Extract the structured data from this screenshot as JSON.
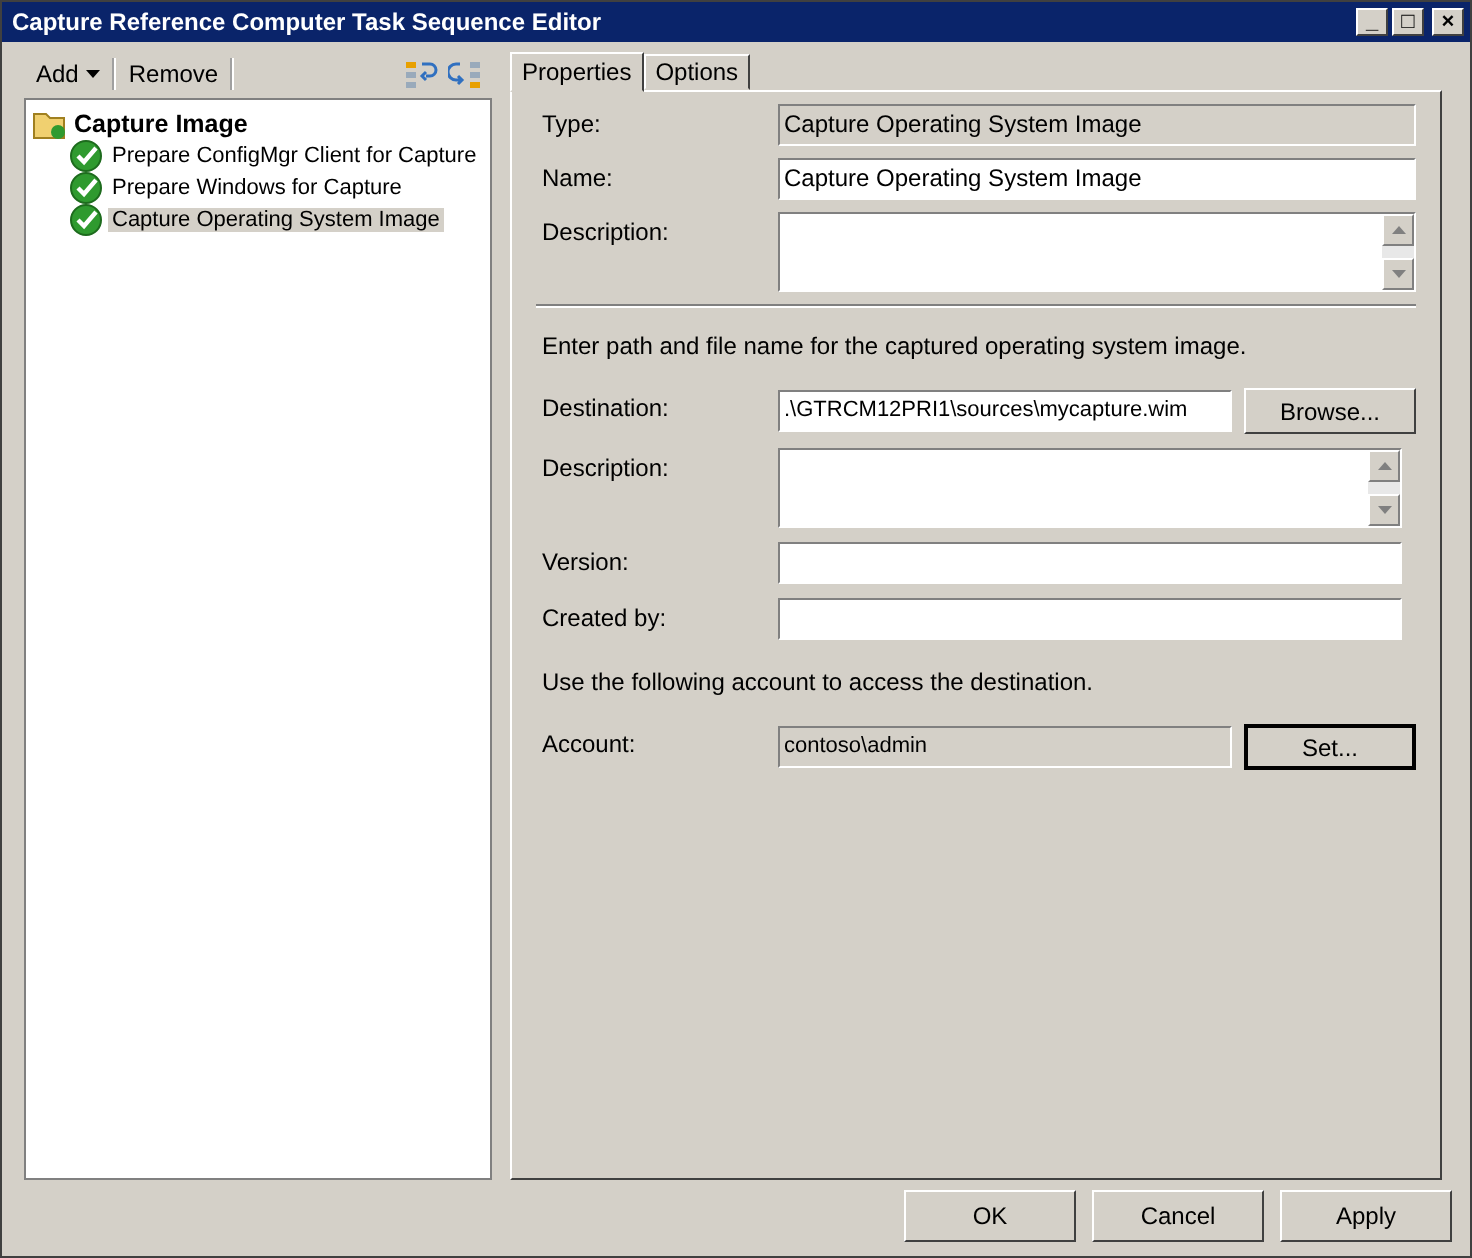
{
  "window": {
    "title": "Capture Reference Computer Task Sequence Editor",
    "controls": [
      "_",
      "□",
      "×"
    ]
  },
  "toolbar": {
    "add": "Add",
    "remove": "Remove"
  },
  "tree": {
    "label": "Capture Image",
    "children": [
      {
        "label": "Prepare ConfigMgr Client for Capture",
        "selected": false
      },
      {
        "label": "Prepare Windows for Capture",
        "selected": false
      },
      {
        "label": "Capture Operating System Image",
        "selected": true
      }
    ]
  },
  "tabs": [
    {
      "label": "Properties",
      "selected": true
    },
    {
      "label": "Options",
      "selected": false
    }
  ],
  "properties": [
    {
      "label": "Type:",
      "kind": "readonly",
      "value": "Capture Operating System Image"
    },
    {
      "label": "Name:",
      "kind": "text",
      "value": "Capture Operating System Image"
    },
    {
      "label": "Description:",
      "kind": "multiline"
    }
  ],
  "capture": {
    "instruction": "Enter path and file name for the captured operating system image.",
    "fields": [
      {
        "label": "Destination:",
        "kind": "text",
        "value": ".\\GTRCM12PRI1\\sources\\mycapture.wim",
        "button": "Browse..."
      },
      {
        "label": "Description:",
        "kind": "multiline"
      },
      {
        "label": "Version:",
        "kind": "text"
      },
      {
        "label": "Created by:",
        "kind": "text"
      }
    ],
    "account_note": "Use the following account to access the destination.",
    "account": {
      "label": "Account:",
      "kind": "readonly",
      "value": "contoso\\admin",
      "button": "Set..."
    }
  },
  "buttons": [
    "OK",
    "Cancel",
    "Apply"
  ]
}
